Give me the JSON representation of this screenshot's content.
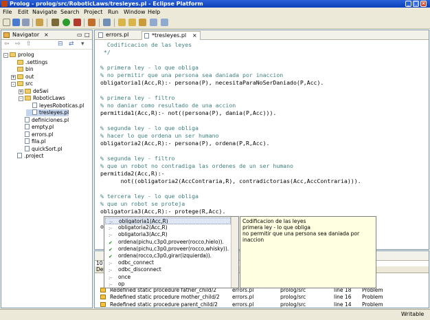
{
  "window": {
    "title": "Prolog - prolog/src/RoboticLaws/tresleyes.pl - Eclipse Platform"
  },
  "menu": [
    "File",
    "Edit",
    "Navigate",
    "Search",
    "Project",
    "Run",
    "Window",
    "Help"
  ],
  "navigator": {
    "title": "Navigator",
    "tree": [
      {
        "label": "prolog",
        "kind": "folder",
        "level": 0,
        "expander": "-"
      },
      {
        "label": ".settings",
        "kind": "folder",
        "level": 1,
        "expander": ""
      },
      {
        "label": "bin",
        "kind": "folder",
        "level": 1,
        "expander": ""
      },
      {
        "label": "out",
        "kind": "folder",
        "level": 1,
        "expander": "+"
      },
      {
        "label": "src",
        "kind": "folder",
        "level": 1,
        "expander": "-"
      },
      {
        "label": "deSwi",
        "kind": "folder",
        "level": 2,
        "expander": "+"
      },
      {
        "label": "RoboticLaws",
        "kind": "folder",
        "level": 2,
        "expander": "-"
      },
      {
        "label": "leyesRoboticas.pl",
        "kind": "file",
        "level": 3,
        "expander": ""
      },
      {
        "label": "tresleyes.pl",
        "kind": "file",
        "level": 3,
        "expander": "",
        "selected": true
      },
      {
        "label": "definiciones.pl",
        "kind": "file",
        "level": 2,
        "expander": ""
      },
      {
        "label": "empty.pl",
        "kind": "file",
        "level": 2,
        "expander": ""
      },
      {
        "label": "errors.pl",
        "kind": "file",
        "level": 2,
        "expander": ""
      },
      {
        "label": "fila.pl",
        "kind": "file",
        "level": 2,
        "expander": ""
      },
      {
        "label": "quickSort.pl",
        "kind": "file",
        "level": 2,
        "expander": ""
      },
      {
        "label": ".project",
        "kind": "file",
        "level": 1,
        "expander": ""
      }
    ]
  },
  "editor": {
    "tabs": [
      {
        "label": "errors.pl",
        "active": false
      },
      {
        "label": "*tresleyes.pl",
        "active": true
      }
    ],
    "lines": [
      {
        "text": "  Codificacion de las leyes",
        "type": "comment"
      },
      {
        "text": " */",
        "type": "comment"
      },
      {
        "text": "",
        "type": "code"
      },
      {
        "text": "% primera ley - lo que obliga",
        "type": "comment"
      },
      {
        "text": "% no permitir que una persona sea daniada por inaccion",
        "type": "comment"
      },
      {
        "text": "obligatoria1(Acc,R):- persona(P), necesitaParaNoSerDaniado(P,Acc).",
        "type": "code"
      },
      {
        "text": "",
        "type": "code"
      },
      {
        "text": "% primera ley - filtro",
        "type": "comment"
      },
      {
        "text": "% no daniar como resultado de una accion",
        "type": "comment"
      },
      {
        "text": "permitida1(Acc,R):- not((persona(P), dania(P,Acc))).",
        "type": "code"
      },
      {
        "text": "",
        "type": "code"
      },
      {
        "text": "% segunda ley - lo que obliga",
        "type": "comment"
      },
      {
        "text": "% hacer lo que ordena un ser humano",
        "type": "comment"
      },
      {
        "text": "obligatoria2(Acc,R):- persona(P), ordena(P,R,Acc).",
        "type": "code"
      },
      {
        "text": "",
        "type": "code"
      },
      {
        "text": "% segunda ley - filtro",
        "type": "comment"
      },
      {
        "text": "% que un robot no contradiga las ordenes de un ser humano",
        "type": "comment"
      },
      {
        "text": "permitida2(Acc,R):-",
        "type": "code"
      },
      {
        "text": "      not((obligatoria2(AccContraria,R), contradictorias(Acc,AccContraria))).",
        "type": "code"
      },
      {
        "text": "",
        "type": "code"
      },
      {
        "text": "% tercera ley - lo que obliga",
        "type": "comment"
      },
      {
        "text": "% que un robot se proteja",
        "type": "comment"
      },
      {
        "text": "obligatoria3(Acc,R):- protege(R,Acc).",
        "type": "code"
      },
      {
        "text": "",
        "type": "code"
      },
      {
        "text": "o|",
        "type": "code"
      }
    ]
  },
  "content_assist": {
    "items": [
      {
        "label": "obligatoria1(Acc,R)",
        "icon": "dash",
        "selected": true
      },
      {
        "label": "obligatoria2(Acc,R)",
        "icon": "dash"
      },
      {
        "label": "obligatoria3(Acc,R)",
        "icon": "dash"
      },
      {
        "label": "ordena(pichu,c3p0,proveer(rocco,hielo)).",
        "icon": "check"
      },
      {
        "label": "ordena(pichu,c3p0,proveer(rocco,whisky)).",
        "icon": "check"
      },
      {
        "label": "ordena(rocco,c3p0,girar(izquierda)).",
        "icon": "check"
      },
      {
        "label": "odbc_connect",
        "icon": "dash"
      },
      {
        "label": "odbc_disconnect",
        "icon": "dash"
      },
      {
        "label": "once",
        "icon": "dash"
      },
      {
        "label": "op",
        "icon": "dash"
      }
    ],
    "doc": [
      "Codificacion de las leyes",
      "primera ley - lo que obliga",
      "no permitir que una persona sea daniada por inaccion"
    ]
  },
  "problems": {
    "count_label": "10 it",
    "header_label": "Des",
    "rows": [
      {
        "description": "Redefined static procedure father_child/2",
        "resource": "errors.pl",
        "path": "prolog/src",
        "location": "line 18",
        "type": "Problem"
      },
      {
        "description": "Redefined static procedure mother_child/2",
        "resource": "errors.pl",
        "path": "prolog/src",
        "location": "line 16",
        "type": "Problem"
      },
      {
        "description": "Redefined static procedure parent_child/2",
        "resource": "errors.pl",
        "path": "prolog/src",
        "location": "line 14",
        "type": "Problem"
      }
    ]
  },
  "status": {
    "mode": "Writable"
  },
  "colors": {
    "comment": "#3f7f7f",
    "titlebar": "#0a3fb8",
    "selection": "#dfe6f5",
    "doc_bg": "#ffffe1"
  }
}
